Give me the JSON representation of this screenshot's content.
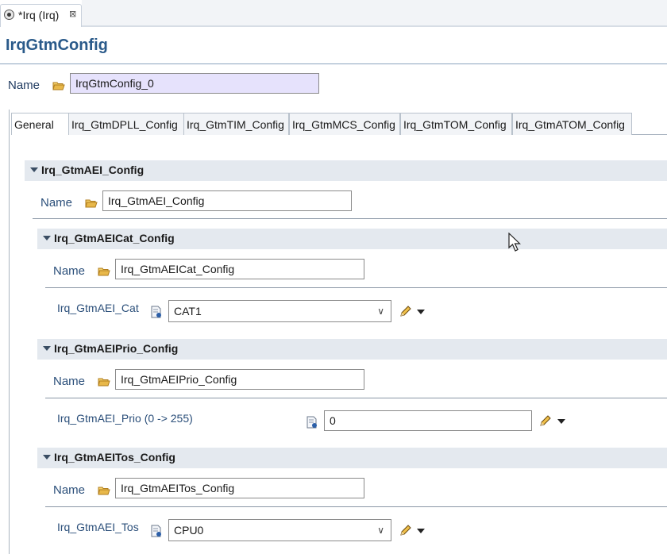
{
  "editor": {
    "tab_title": "*Irq (Irq)"
  },
  "page": {
    "title": "IrqGtmConfig",
    "name_label": "Name",
    "name_value": "IrqGtmConfig_0"
  },
  "tabs": [
    {
      "label": "General"
    },
    {
      "label": "Irq_GtmDPLL_Config"
    },
    {
      "label": "Irq_GtmTIM_Config"
    },
    {
      "label": "Irq_GtmMCS_Config"
    },
    {
      "label": "Irq_GtmTOM_Config"
    },
    {
      "label": "Irq_GtmATOM_Config"
    }
  ],
  "aei": {
    "title": "Irq_GtmAEI_Config",
    "name_label": "Name",
    "name_value": "Irq_GtmAEI_Config"
  },
  "cat": {
    "title": "Irq_GtmAEICat_Config",
    "name_label": "Name",
    "name_value": "Irq_GtmAEICat_Config",
    "param_label": "Irq_GtmAEI_Cat",
    "param_value": "CAT1"
  },
  "prio": {
    "title": "Irq_GtmAEIPrio_Config",
    "name_label": "Name",
    "name_value": "Irq_GtmAEIPrio_Config",
    "param_label": "Irq_GtmAEI_Prio (0 -> 255)",
    "param_value": "0"
  },
  "tos": {
    "title": "Irq_GtmAEITos_Config",
    "name_label": "Name",
    "name_value": "Irq_GtmAEITos_Config",
    "param_label": "Irq_GtmAEI_Tos",
    "param_value": "CPU0"
  },
  "icons": {
    "editor_tab": "target-icon",
    "close": "close-icon",
    "folder": "folder-icon",
    "config": "config-doc-icon",
    "edit": "pencil-icon",
    "dropdown": "dropdown-arrow-icon",
    "collapse": "chevron-down-icon",
    "cursor": "mouse-cursor-icon"
  },
  "colors": {
    "title": "#2a5a8a",
    "label": "#2b4f7a",
    "section_bar": "#e4e9ef",
    "highlight_input": "#e6e2fc",
    "folder": "#e8b84a"
  }
}
